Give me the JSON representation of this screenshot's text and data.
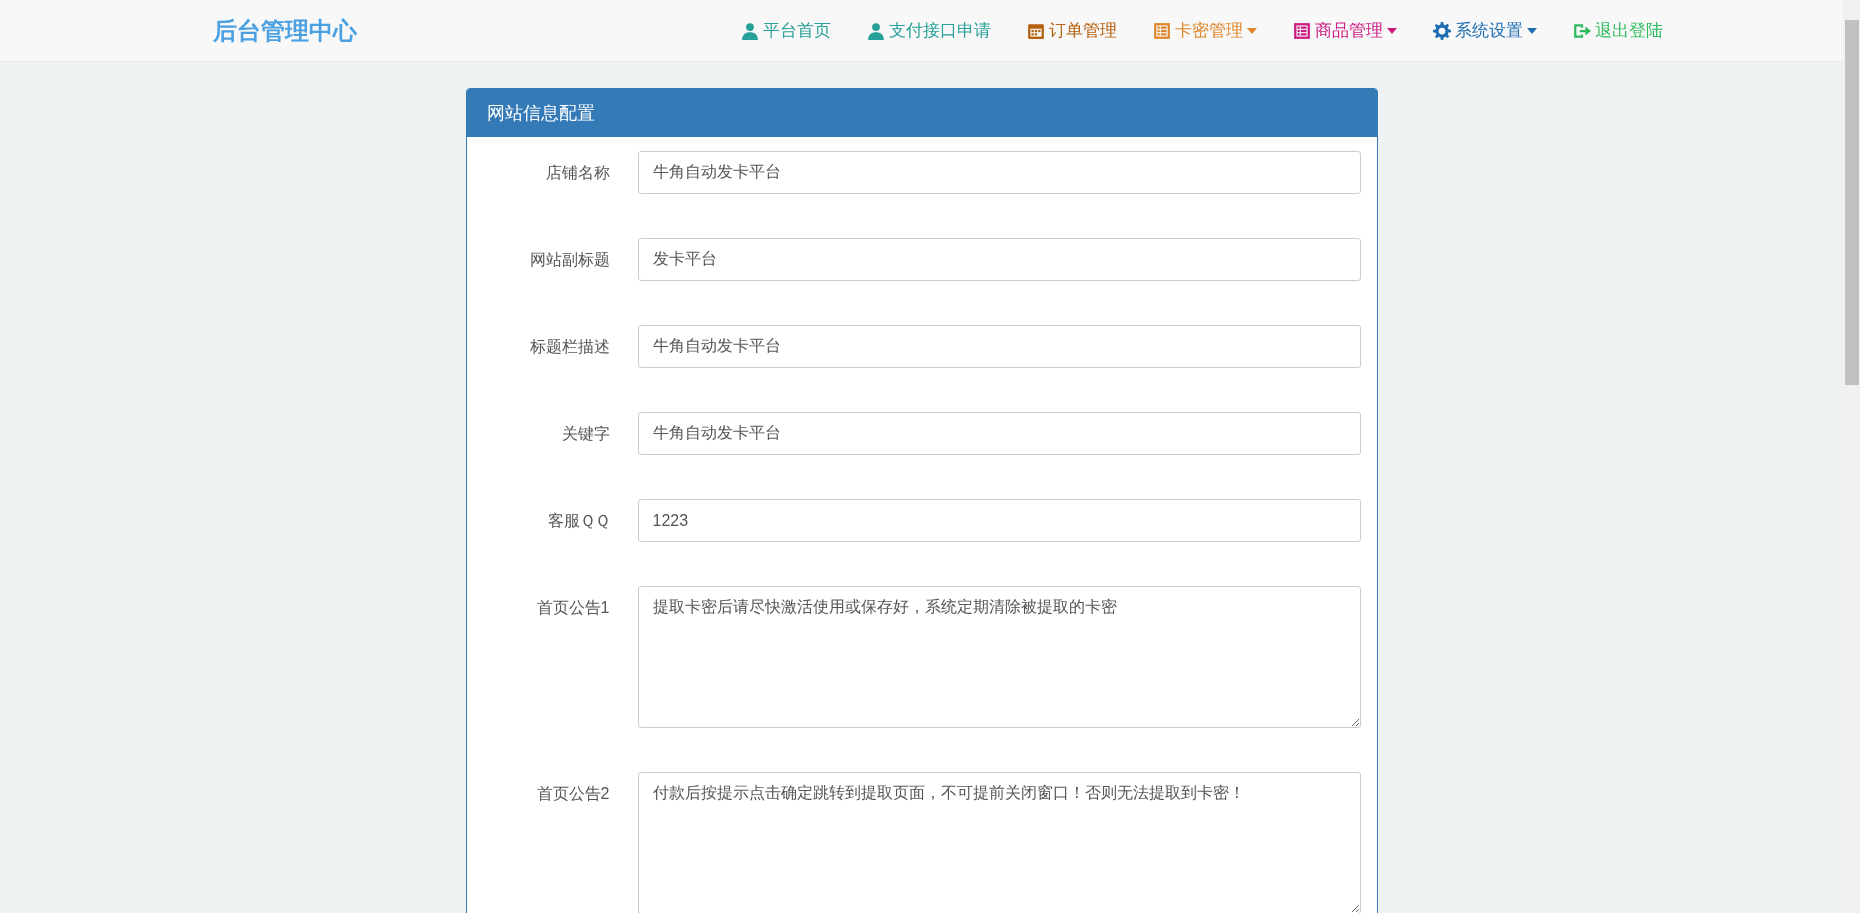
{
  "navbar": {
    "brand": "后台管理中心",
    "items": [
      {
        "label": "平台首页",
        "kind": "user",
        "color": "#27a09a",
        "dropdown": false
      },
      {
        "label": "支付接口申请",
        "kind": "user",
        "color": "#27a09a",
        "dropdown": false
      },
      {
        "label": "订单管理",
        "kind": "calendar",
        "color": "#b5600c",
        "dropdown": false
      },
      {
        "label": "卡密管理",
        "kind": "list",
        "color": "#e0862a",
        "dropdown": true
      },
      {
        "label": "商品管理",
        "kind": "list",
        "color": "#cc1a82",
        "dropdown": true
      },
      {
        "label": "系统设置",
        "kind": "gear",
        "color": "#1f6eb3",
        "dropdown": true
      },
      {
        "label": "退出登陆",
        "kind": "logout",
        "color": "#2dbb5d",
        "dropdown": false
      }
    ]
  },
  "panel": {
    "title": "网站信息配置",
    "fields": [
      {
        "label": "店铺名称",
        "kind": "input",
        "value": "牛角自动发卡平台"
      },
      {
        "label": "网站副标题",
        "kind": "input",
        "value": "发卡平台"
      },
      {
        "label": "标题栏描述",
        "kind": "input",
        "value": "牛角自动发卡平台"
      },
      {
        "label": "关键字",
        "kind": "input",
        "value": "牛角自动发卡平台"
      },
      {
        "label": "客服ＱＱ",
        "kind": "input",
        "value": "1223"
      },
      {
        "label": "首页公告1",
        "kind": "textarea",
        "value": "提取卡密后请尽快激活使用或保存好，系统定期清除被提取的卡密"
      },
      {
        "label": "首页公告2",
        "kind": "textarea",
        "value": "付款后按提示点击确定跳转到提取页面，不可提前关闭窗口！否则无法提取到卡密！"
      }
    ]
  }
}
